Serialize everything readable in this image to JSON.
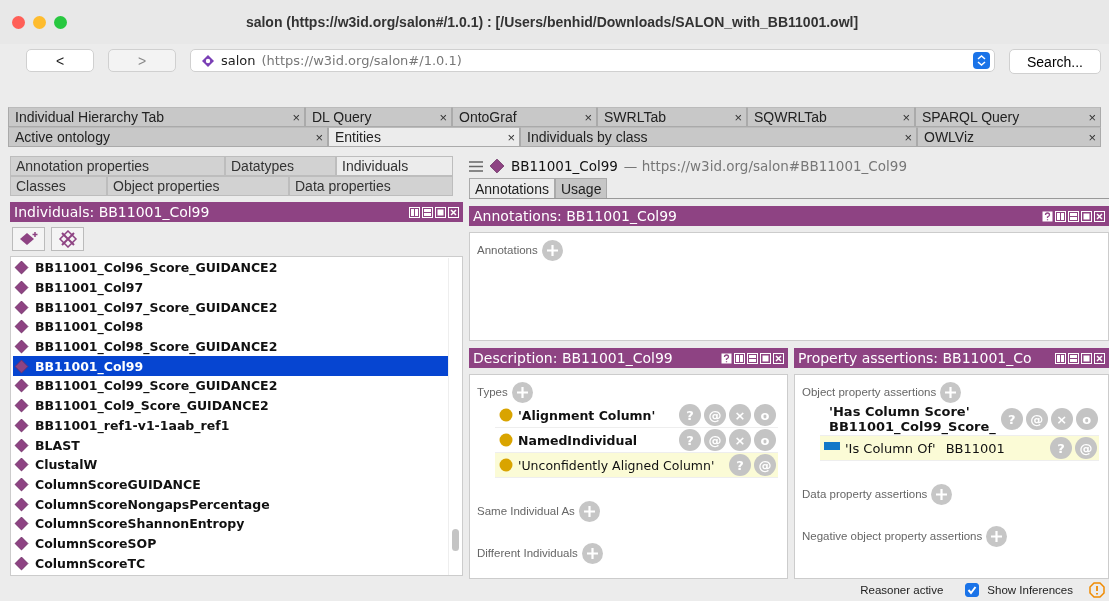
{
  "window": {
    "title": "salon (https://w3id.org/salon#/1.0.1)  : [/Users/benhid/Downloads/SALON_with_BB11001.owl]"
  },
  "toolbar": {
    "back": "<",
    "forward": ">",
    "ontology_name": "salon",
    "ontology_iri": "(https://w3id.org/salon#/1.0.1)",
    "search": "Search..."
  },
  "workspace_tabs": [
    [
      {
        "label": "Individual Hierarchy Tab",
        "selected": false,
        "close": "×"
      },
      {
        "label": "DL Query",
        "selected": false,
        "close": "×"
      },
      {
        "label": "OntoGraf",
        "selected": false,
        "close": "×"
      },
      {
        "label": "SWRLTab",
        "selected": false,
        "close": "×"
      },
      {
        "label": "SQWRLTab",
        "selected": false,
        "close": "×"
      },
      {
        "label": "SPARQL Query",
        "selected": false,
        "close": "×"
      }
    ],
    [
      {
        "label": "Active ontology",
        "selected": false,
        "close": "×"
      },
      {
        "label": "Entities",
        "selected": true,
        "close": "×"
      },
      {
        "label": "Individuals by class",
        "selected": false,
        "close": "×"
      },
      {
        "label": "OWLViz",
        "selected": false,
        "close": "×"
      }
    ]
  ],
  "entity_tabs": [
    [
      {
        "label": "Annotation properties",
        "selected": false
      },
      {
        "label": "Datatypes",
        "selected": false
      },
      {
        "label": "Individuals",
        "selected": true
      }
    ],
    [
      {
        "label": "Classes",
        "selected": false
      },
      {
        "label": "Object properties",
        "selected": false
      },
      {
        "label": "Data properties",
        "selected": false
      }
    ]
  ],
  "individuals_panel": {
    "title": "Individuals: BB11001_Col99",
    "items": [
      {
        "label": "BB11001_Col96_Score_GUIDANCE2",
        "selected": false
      },
      {
        "label": "BB11001_Col97",
        "selected": false
      },
      {
        "label": "BB11001_Col97_Score_GUIDANCE2",
        "selected": false
      },
      {
        "label": "BB11001_Col98",
        "selected": false
      },
      {
        "label": "BB11001_Col98_Score_GUIDANCE2",
        "selected": false
      },
      {
        "label": "BB11001_Col99",
        "selected": true
      },
      {
        "label": "BB11001_Col99_Score_GUIDANCE2",
        "selected": false
      },
      {
        "label": "BB11001_Col9_Score_GUIDANCE2",
        "selected": false
      },
      {
        "label": "BB11001_ref1-v1-1aab_ref1",
        "selected": false
      },
      {
        "label": "BLAST",
        "selected": false
      },
      {
        "label": "ClustalW",
        "selected": false
      },
      {
        "label": "ColumnScoreGUIDANCE",
        "selected": false
      },
      {
        "label": "ColumnScoreNongapsPercentage",
        "selected": false
      },
      {
        "label": "ColumnScoreShannonEntropy",
        "selected": false
      },
      {
        "label": "ColumnScoreSOP",
        "selected": false
      },
      {
        "label": "ColumnScoreTC",
        "selected": false
      }
    ]
  },
  "entity": {
    "name": "BB11001_Col99",
    "iri": "— https://w3id.org/salon#BB11001_Col99"
  },
  "view_tabs": [
    {
      "label": "Annotations",
      "selected": true
    },
    {
      "label": "Usage",
      "selected": false
    }
  ],
  "annotations_panel": {
    "title": "Annotations: BB11001_Col99",
    "help_button": true,
    "section": "Annotations"
  },
  "description_panel": {
    "title": "Description: BB11001_Col99",
    "help_button": true,
    "sections": [
      {
        "label": "Types",
        "items": [
          {
            "label": "'Alignment Column'",
            "inferred": false,
            "actions": [
              "?",
              "@",
              "×",
              "o"
            ]
          },
          {
            "label": "NamedIndividual",
            "inferred": false,
            "actions": [
              "?",
              "@",
              "×",
              "o"
            ]
          },
          {
            "label": "'Unconfidently Aligned Column'",
            "inferred": true,
            "actions": [
              "?",
              "@"
            ]
          }
        ]
      },
      {
        "label": "Same Individual As"
      },
      {
        "label": "Different Individuals"
      }
    ]
  },
  "property_panel": {
    "title": "Property assertions: BB11001_Co",
    "sections": [
      {
        "label": "Object property assertions",
        "items": [
          {
            "property": "'Has Column Score'",
            "value": "BB11001_Col99_Score_",
            "inferred": false,
            "actions": [
              "?",
              "@",
              "×",
              "o"
            ]
          },
          {
            "property": "'Is Column Of'",
            "value": "BB11001",
            "inferred": true,
            "actions": [
              "?",
              "@"
            ]
          }
        ]
      },
      {
        "label": "Data property assertions"
      },
      {
        "label": "Negative object property assertions"
      }
    ]
  },
  "status_bar": {
    "reasoner": "Reasoner active",
    "show_inferences": {
      "label": "Show Inferences",
      "checked": true
    }
  }
}
